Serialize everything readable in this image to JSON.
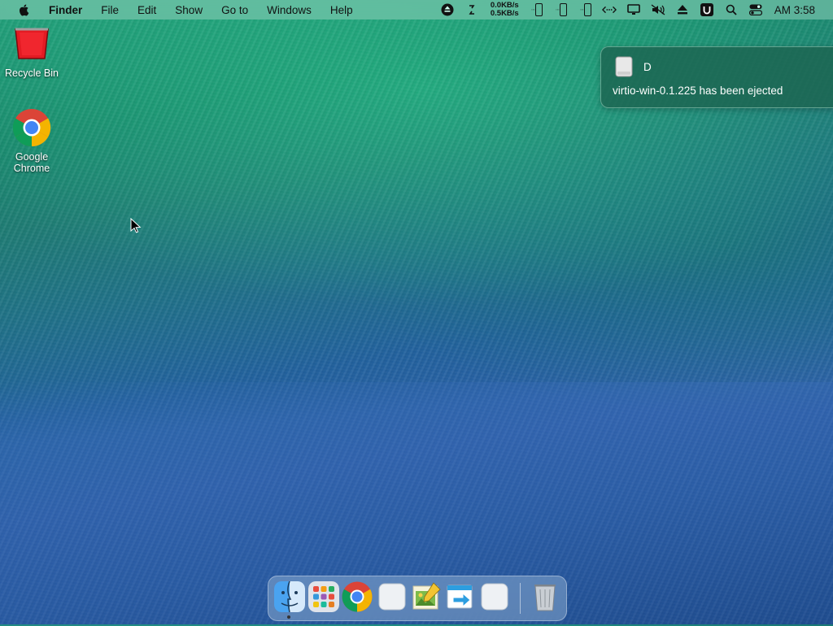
{
  "menubar": {
    "app_name": "Finder",
    "menus": [
      "File",
      "Edit",
      "Show",
      "Go to",
      "Windows",
      "Help"
    ],
    "net_up": "0.0KB/s",
    "net_down": "0.5KB/s",
    "clock": "AM 3:58",
    "status_icons": [
      "eject-icon",
      "refresh-icon",
      "battery-icon",
      "battery-icon",
      "battery-icon",
      "network-icon",
      "display-icon",
      "mute-icon",
      "eject-icon",
      "u-app-icon",
      "search-icon",
      "control-center-icon"
    ]
  },
  "desktop": {
    "icons": [
      {
        "label": "Recycle Bin"
      },
      {
        "label": "Google\nChrome"
      }
    ]
  },
  "notification": {
    "title": "D",
    "body": "virtio-win-0.1.225 has been ejected"
  },
  "dock": {
    "items": [
      "finder-icon",
      "launchpad-icon",
      "chrome-icon",
      "blank-app-icon",
      "image-app-icon",
      "migration-app-icon",
      "blank-app-icon",
      "trash-icon"
    ]
  }
}
